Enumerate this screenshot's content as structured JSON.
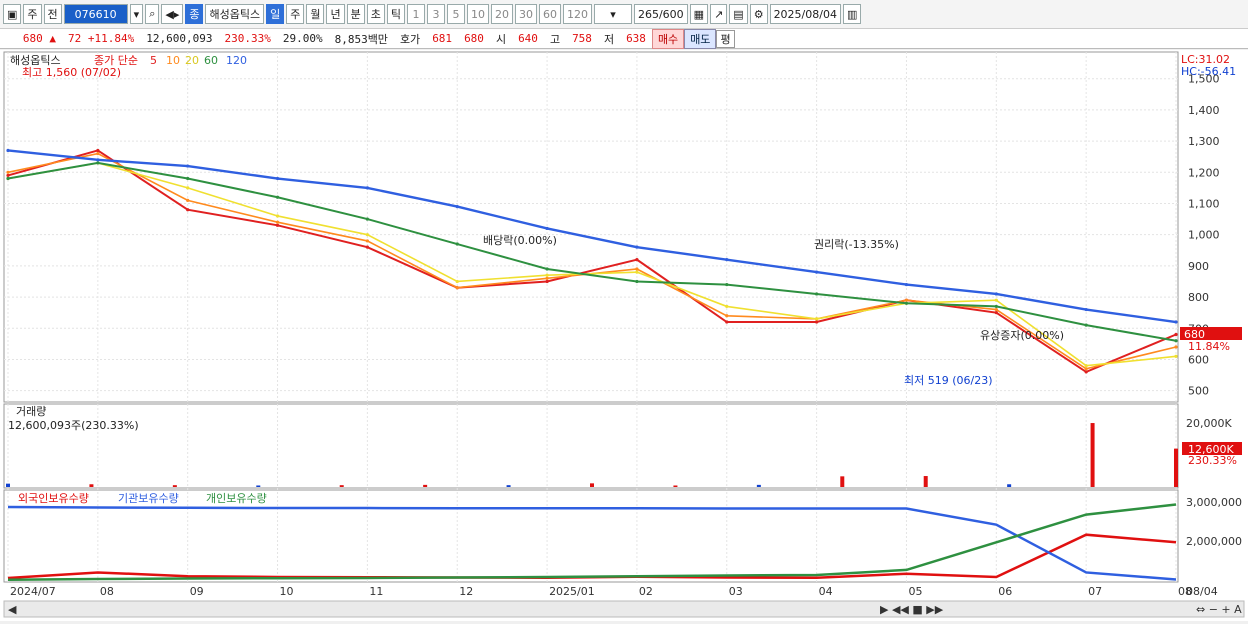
{
  "toolbar": {
    "period_label": "주",
    "prev_label": "전",
    "code": "076610",
    "name_tag": "종",
    "name": "해성옵틱스",
    "periods": [
      "일",
      "주",
      "월",
      "년",
      "분",
      "초",
      "틱"
    ],
    "active_period": "일",
    "intervals": [
      "1",
      "3",
      "5",
      "10",
      "20",
      "30",
      "60",
      "120"
    ],
    "count": "265",
    "count_max": "/600",
    "date": "2025/08/04"
  },
  "quote": {
    "price": "680",
    "arrow": "▲",
    "change": "72",
    "change_pct": "+11.84%",
    "volume": "12,600,093",
    "vol_ratio": "230.33%",
    "turnover": "29.00%",
    "amount": "8,853백만",
    "bid_label": "호가",
    "ask": "681",
    "bid": "680",
    "open_label": "시",
    "open": "640",
    "high_label": "고",
    "high": "758",
    "low_label": "저",
    "low": "638",
    "buy_label": "매수",
    "sell_label": "매도",
    "avg_label": "평"
  },
  "price_panel": {
    "name": "해성옵틱스",
    "ma_legend": "종가 단순",
    "ma_periods": [
      {
        "label": "5",
        "color": "#e02020"
      },
      {
        "label": "10",
        "color": "#ff8a1e"
      },
      {
        "label": "20",
        "color": "#f0e030"
      },
      {
        "label": "60",
        "color": "#2e9040"
      },
      {
        "label": "120",
        "color": "#2f5fe0"
      }
    ],
    "high_note": "최고 1,560 (07/02)",
    "lc": "LC:31.02",
    "hc": "HC:-56.41",
    "last_price": "680",
    "last_pct": "11.84%",
    "low_note": "최저 519 (06/23)",
    "events": [
      {
        "label": "배당락(0.00%)"
      },
      {
        "label": "권리락(-13.35%)"
      },
      {
        "label": "유상증자(0.00%)"
      }
    ]
  },
  "volume_panel": {
    "title": "거래량",
    "value": "12,600,093주(230.33%)",
    "last_label": "12,600K",
    "last_pct": "230.33%",
    "y_labels": [
      "20,000K",
      "10,000K"
    ]
  },
  "holding_panel": {
    "legends": [
      {
        "label": "외국인보유수량",
        "color": "#e01010"
      },
      {
        "label": "기관보유수량",
        "color": "#2f5fe0"
      },
      {
        "label": "개인보유수량",
        "color": "#2e9040"
      }
    ],
    "y_labels": [
      "3,000,000",
      "2,000,000"
    ]
  },
  "x_axis": {
    "labels": [
      "2024/07",
      "08",
      "09",
      "10",
      "11",
      "12",
      "2025/01",
      "02",
      "03",
      "04",
      "05",
      "06",
      "07",
      "08"
    ],
    "right_label": "08/04"
  },
  "chart_data": {
    "type": "line",
    "title": "해성옵틱스",
    "x": [
      "2024/07",
      "2024/08",
      "2024/09",
      "2024/10",
      "2024/11",
      "2024/12",
      "2025/01",
      "2025/02",
      "2025/03",
      "2025/04",
      "2025/05",
      "2025/06",
      "2025/07",
      "2025/08/04"
    ],
    "ylim": [
      470,
      1560
    ],
    "y_ticks": [
      500,
      600,
      700,
      800,
      900,
      1000,
      1100,
      1200,
      1300,
      1400,
      1500
    ],
    "series": [
      {
        "name": "5",
        "values": [
          1190,
          1270,
          1080,
          1030,
          960,
          830,
          850,
          920,
          720,
          720,
          790,
          750,
          560,
          680
        ]
      },
      {
        "name": "10",
        "values": [
          1200,
          1260,
          1110,
          1040,
          980,
          830,
          860,
          890,
          740,
          730,
          790,
          760,
          570,
          640
        ]
      },
      {
        "name": "20",
        "values": [
          1180,
          1230,
          1150,
          1060,
          1000,
          850,
          870,
          880,
          770,
          730,
          780,
          790,
          580,
          610
        ]
      },
      {
        "name": "60",
        "values": [
          1180,
          1230,
          1180,
          1120,
          1050,
          970,
          890,
          850,
          840,
          810,
          780,
          770,
          710,
          660
        ]
      },
      {
        "name": "120",
        "values": [
          1270,
          1240,
          1220,
          1180,
          1150,
          1090,
          1020,
          960,
          920,
          880,
          840,
          810,
          760,
          720
        ]
      }
    ],
    "volume_k": [
      1100,
      900,
      600,
      500,
      600,
      700,
      600,
      1200,
      500,
      700,
      3500,
      3600,
      900,
      21000,
      12600
    ],
    "holdings": {
      "foreign": [
        80000,
        300000,
        150000,
        120000,
        110000,
        100000,
        90000,
        130000,
        100000,
        90000,
        250000,
        120000,
        1800000,
        1500000
      ],
      "institution": [
        2900000,
        2880000,
        2870000,
        2860000,
        2860000,
        2850000,
        2850000,
        2850000,
        2840000,
        2840000,
        2840000,
        2200000,
        300000,
        20000
      ],
      "individual": [
        10000,
        40000,
        60000,
        70000,
        80000,
        100000,
        120000,
        150000,
        180000,
        200000,
        400000,
        1500000,
        2600000,
        3000000
      ]
    },
    "grid": true
  }
}
